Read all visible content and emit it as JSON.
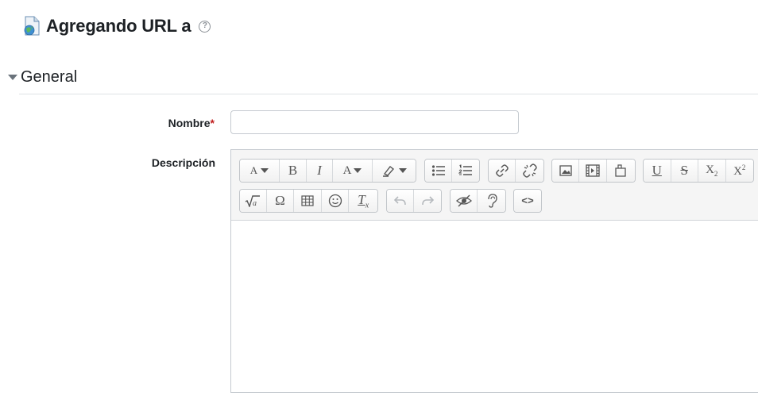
{
  "header": {
    "title": "Agregando URL a",
    "help": "?"
  },
  "section": {
    "title": "General"
  },
  "fields": {
    "nombre_label": "Nombre",
    "required_mark": "*",
    "nombre_value": "",
    "descripcion_label": "Descripción"
  },
  "editor": {
    "content": "",
    "toolbar_row1": [
      [
        "font-size-icon",
        "bold-icon",
        "italic-icon",
        "text-color-icon",
        "background-color-icon"
      ],
      [
        "unordered-list-icon",
        "ordered-list-icon"
      ],
      [
        "link-icon",
        "unlink-icon"
      ],
      [
        "image-icon",
        "media-icon",
        "manage-files-icon"
      ],
      [
        "underline-icon",
        "strikethrough-icon",
        "subscript-icon",
        "superscript-icon"
      ]
    ],
    "toolbar_row2": [
      [
        "equation-icon",
        "special-characters-icon",
        "table-icon",
        "emoticon-icon",
        "clear-formatting-icon"
      ],
      [
        "undo-icon",
        "redo-icon"
      ],
      [
        "accessibility-checker-icon",
        "screenreader-helper-icon"
      ],
      [
        "html-source-icon"
      ]
    ],
    "glyphs": {
      "bold": "B",
      "italic": "I",
      "omega": "Ω",
      "underline": "U",
      "strike": "S",
      "sub": "X",
      "sub_index": "2",
      "sup": "X",
      "sup_index": "2",
      "clear": "T",
      "clear_index": "x",
      "font_a": "A",
      "text_a": "A",
      "source": "<>"
    }
  }
}
